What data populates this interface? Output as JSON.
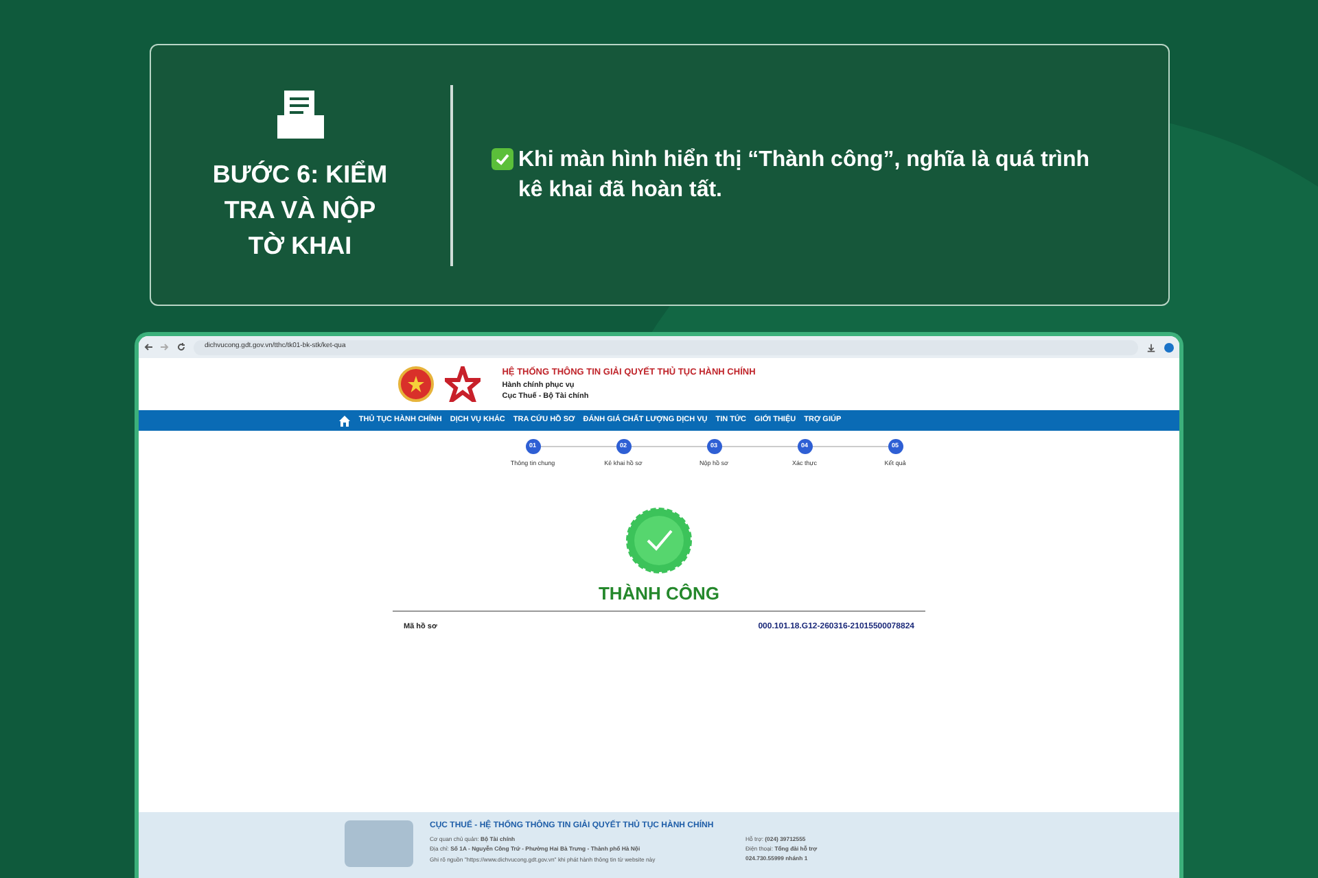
{
  "step": {
    "title": "BƯỚC 6: KIỂM TRA VÀ NỘP TỜ KHAI",
    "text": "Khi màn hình hiển thị “Thành công”, nghĩa là quá trình kê khai đã hoàn tất."
  },
  "browser": {
    "url": "dichvucong.gdt.gov.vn/tthc/tk01-bk-stk/ket-qua"
  },
  "site": {
    "title": "HỆ THỐNG THÔNG TIN GIẢI QUYẾT THỦ TỤC HÀNH CHÍNH",
    "subtitle": "Hành chính phục vụ",
    "agency": "Cục Thuế - Bộ Tài chính"
  },
  "nav": [
    "THỦ TỤC HÀNH CHÍNH",
    "DỊCH VỤ KHÁC",
    "TRA CỨU HỒ SƠ",
    "ĐÁNH GIÁ CHẤT LƯỢNG DỊCH VỤ",
    "TIN TỨC",
    "GIỚI THIỆU",
    "TRỢ GIÚP"
  ],
  "steps": [
    {
      "number": "01",
      "label": "Thông tin chung"
    },
    {
      "number": "02",
      "label": "Kê khai hồ sơ"
    },
    {
      "number": "03",
      "label": "Nộp hồ sơ"
    },
    {
      "number": "04",
      "label": "Xác thực"
    },
    {
      "number": "05",
      "label": "Kết quả"
    }
  ],
  "result": {
    "title": "THÀNH CÔNG",
    "field_label": "Mã hồ sơ",
    "field_value": "000.101.18.G12-260316-21015500078824"
  },
  "footer": {
    "heading": "CỤC THUẾ - HỆ THỐNG THÔNG TIN GIẢI QUYẾT THỦ TỤC HÀNH CHÍNH",
    "left": [
      "Cơ quan chủ quản: **Bộ Tài chính**",
      "Địa chỉ: **Số 1A - Nguyễn Công Trứ - Phường Hai Bà Trưng - Thành phố Hà Nội**",
      "Ghi rõ nguồn \"https://www.dichvucong.gdt.gov.vn\" khi phát hành thông tin từ website này"
    ],
    "right": [
      "Hỗ trợ: **(024) 39712555**",
      "Điện thoại: **Tổng đài hỗ trợ 024.730.55999 nhánh 1**"
    ]
  }
}
